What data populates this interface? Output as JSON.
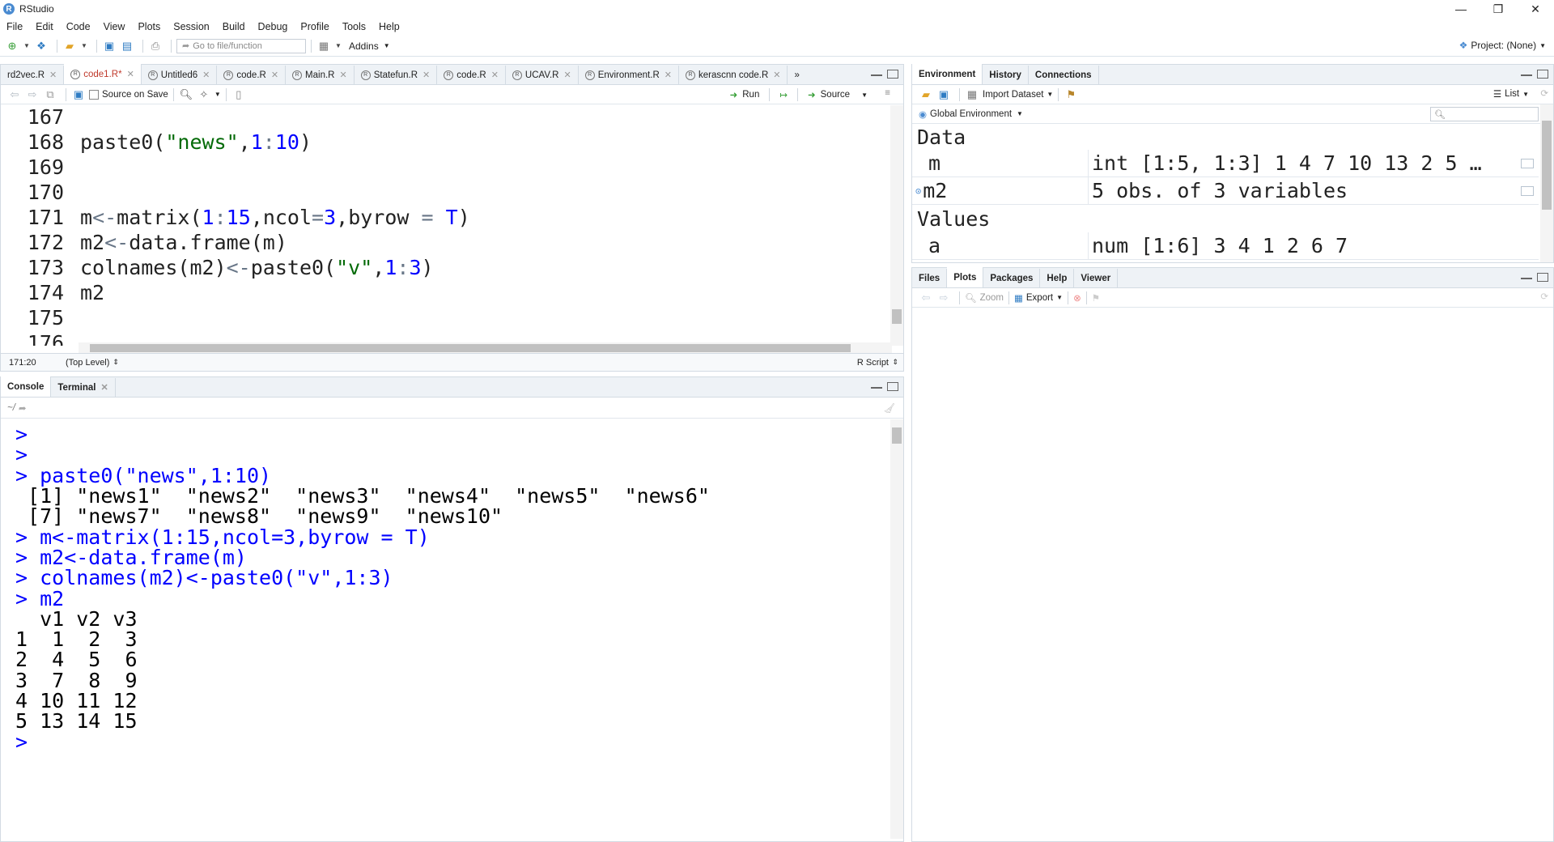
{
  "window": {
    "title": "RStudio",
    "app_icon": "R",
    "controls": [
      "—",
      "❐",
      "✕"
    ]
  },
  "menu": [
    "File",
    "Edit",
    "Code",
    "View",
    "Plots",
    "Session",
    "Build",
    "Debug",
    "Profile",
    "Tools",
    "Help"
  ],
  "toolbar": {
    "goto_placeholder": "Go to file/function",
    "addins_label": "Addins",
    "project_label": "Project: (None)"
  },
  "source": {
    "tabs": [
      {
        "label": "rd2vec.R",
        "active": false
      },
      {
        "label": "code1.R*",
        "active": true
      },
      {
        "label": "Untitled6",
        "active": false
      },
      {
        "label": "code.R",
        "active": false
      },
      {
        "label": "Main.R",
        "active": false
      },
      {
        "label": "Statefun.R",
        "active": false
      },
      {
        "label": "code.R",
        "active": false
      },
      {
        "label": "UCAV.R",
        "active": false
      },
      {
        "label": "Environment.R",
        "active": false
      },
      {
        "label": "kerascnn code.R",
        "active": false
      }
    ],
    "source_on_save_label": "Source on Save",
    "run_label": "Run",
    "source_label": "Source",
    "lines": [
      {
        "num": "167",
        "code": ""
      },
      {
        "num": "168",
        "code": "paste0(\"news\",1:10)"
      },
      {
        "num": "169",
        "code": ""
      },
      {
        "num": "170",
        "code": ""
      },
      {
        "num": "171",
        "code": "m<-matrix(1:15,ncol=3,byrow = T)"
      },
      {
        "num": "172",
        "code": "m2<-data.frame(m)"
      },
      {
        "num": "173",
        "code": "colnames(m2)<-paste0(\"v\",1:3)"
      },
      {
        "num": "174",
        "code": "m2"
      },
      {
        "num": "175",
        "code": ""
      },
      {
        "num": "176",
        "code": ""
      }
    ],
    "status": {
      "position": "171:20",
      "scope": "(Top Level)",
      "filetype": "R Script"
    }
  },
  "console": {
    "tabs": [
      {
        "label": "Console",
        "active": true
      },
      {
        "label": "Terminal",
        "active": false
      }
    ],
    "path": "~/",
    "lines": [
      {
        "type": "cmd",
        "text": ">"
      },
      {
        "type": "cmd",
        "text": ">"
      },
      {
        "type": "cmd",
        "text": "> paste0(\"news\",1:10)"
      },
      {
        "type": "out",
        "text": " [1] \"news1\"  \"news2\"  \"news3\"  \"news4\"  \"news5\"  \"news6\""
      },
      {
        "type": "out",
        "text": " [7] \"news7\"  \"news8\"  \"news9\"  \"news10\""
      },
      {
        "type": "cmd",
        "text": "> m<-matrix(1:15,ncol=3,byrow = T)"
      },
      {
        "type": "cmd",
        "text": "> m2<-data.frame(m)"
      },
      {
        "type": "cmd",
        "text": "> colnames(m2)<-paste0(\"v\",1:3)"
      },
      {
        "type": "cmd",
        "text": "> m2"
      },
      {
        "type": "out",
        "text": "  v1 v2 v3"
      },
      {
        "type": "out",
        "text": "1  1  2  3"
      },
      {
        "type": "out",
        "text": "2  4  5  6"
      },
      {
        "type": "out",
        "text": "3  7  8  9"
      },
      {
        "type": "out",
        "text": "4 10 11 12"
      },
      {
        "type": "out",
        "text": "5 13 14 15"
      },
      {
        "type": "cmd",
        "text": ">"
      }
    ]
  },
  "environment": {
    "tabs": [
      {
        "label": "Environment",
        "active": true
      },
      {
        "label": "History",
        "active": false
      },
      {
        "label": "Connections",
        "active": false
      }
    ],
    "import_label": "Import Dataset",
    "list_label": "List",
    "global_env_label": "Global Environment",
    "data_header": "Data",
    "values_header": "Values",
    "data": [
      {
        "name": "m",
        "value": "int [1:5, 1:3] 1 4 7 10 13 2 5 …"
      },
      {
        "name": "m2",
        "value": "5 obs. of 3 variables"
      }
    ],
    "values": [
      {
        "name": "a",
        "value": "num [1:6] 3 4 1 2 6 7"
      }
    ]
  },
  "files": {
    "tabs": [
      {
        "label": "Files",
        "active": false
      },
      {
        "label": "Plots",
        "active": true
      },
      {
        "label": "Packages",
        "active": false
      },
      {
        "label": "Help",
        "active": false
      },
      {
        "label": "Viewer",
        "active": false
      }
    ],
    "zoom_label": "Zoom",
    "export_label": "Export"
  }
}
